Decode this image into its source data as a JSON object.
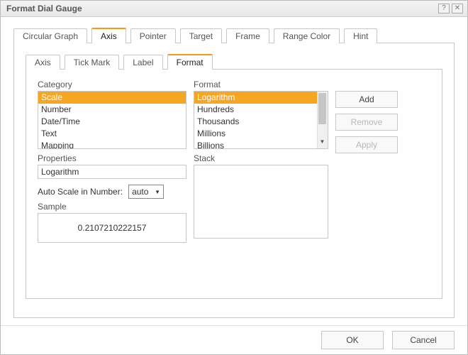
{
  "title": "Format Dial Gauge",
  "outerTabs": {
    "t0": "Circular Graph",
    "t1": "Axis",
    "t2": "Pointer",
    "t3": "Target",
    "t4": "Frame",
    "t5": "Range Color",
    "t6": "Hint"
  },
  "innerTabs": {
    "t0": "Axis",
    "t1": "Tick Mark",
    "t2": "Label",
    "t3": "Format"
  },
  "labels": {
    "category": "Category",
    "format": "Format",
    "properties": "Properties",
    "autoScale": "Auto Scale in Number:",
    "sample": "Sample",
    "stack": "Stack"
  },
  "categoryList": {
    "i0": "Scale",
    "i1": "Number",
    "i2": "Date/Time",
    "i3": "Text",
    "i4": "Mapping"
  },
  "formatList": {
    "i0": "Logarithm",
    "i1": "Hundreds",
    "i2": "Thousands",
    "i3": "Millions",
    "i4": "Billions"
  },
  "propertiesValue": "Logarithm",
  "autoScaleValue": "auto",
  "sampleValue": "0.2107210222157",
  "sideButtons": {
    "add": "Add",
    "remove": "Remove",
    "apply": "Apply"
  },
  "footer": {
    "ok": "OK",
    "cancel": "Cancel"
  }
}
